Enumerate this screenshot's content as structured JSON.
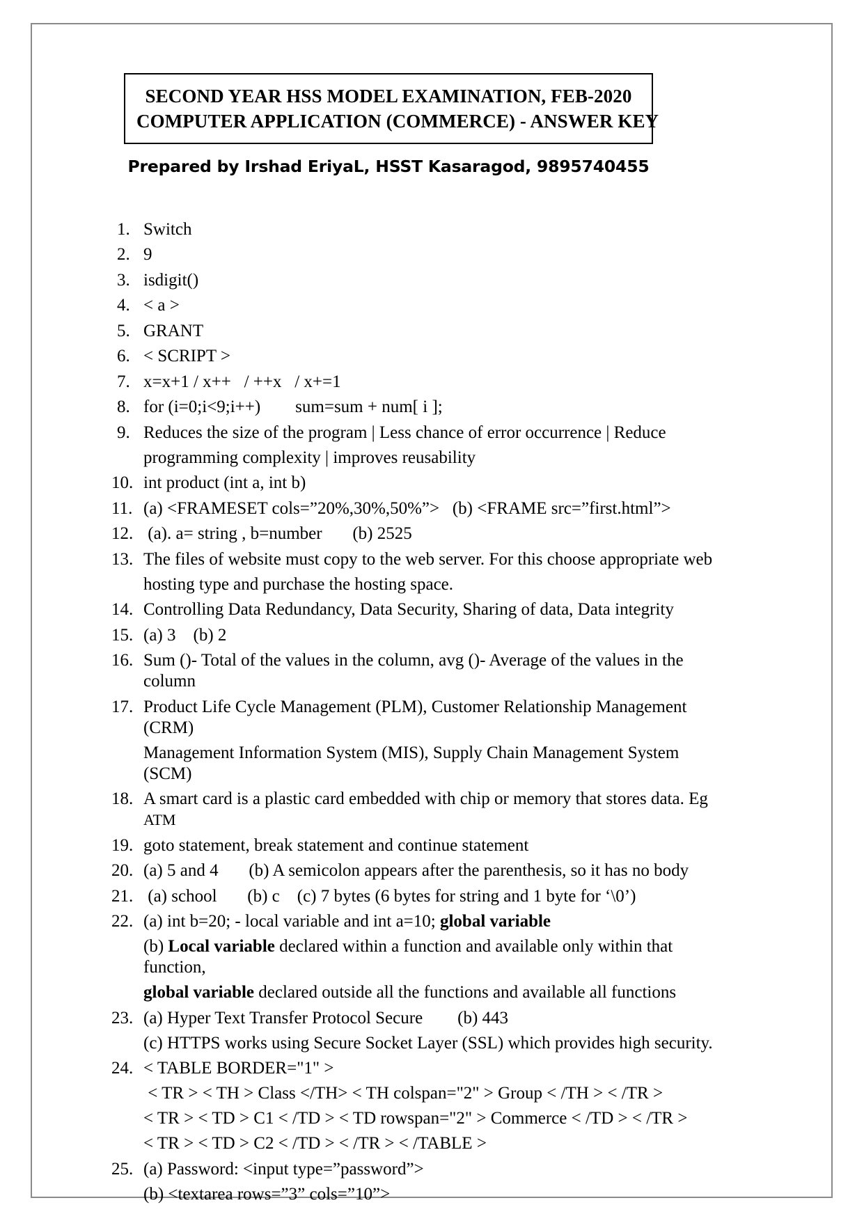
{
  "document": {
    "title_box": {
      "line1": "SECOND YEAR HSS MODEL EXAMINATION, FEB-2020",
      "line2": "COMPUTER APPLICATION (COMMERCE) - ANSWER KEY"
    },
    "subtitle": "Prepared by Irshad EriyaL, HSST Kasaragod, 9895740455",
    "answers": [
      {
        "num": "1.",
        "lines": [
          "Switch"
        ]
      },
      {
        "num": "2.",
        "lines": [
          "9"
        ]
      },
      {
        "num": "3.",
        "lines": [
          "isdigit()"
        ]
      },
      {
        "num": "4.",
        "lines": [
          "< a >"
        ]
      },
      {
        "num": "5.",
        "lines": [
          "GRANT"
        ]
      },
      {
        "num": "6.",
        "lines": [
          "< SCRIPT >"
        ]
      },
      {
        "num": "7.",
        "lines": [
          "x=x+1 / x++   / ++x   / x+=1"
        ]
      },
      {
        "num": "8.",
        "lines": [
          "for (i=0;i<9;i++)        sum=sum + num[ i ];"
        ]
      },
      {
        "num": "9.",
        "lines": [
          "Reduces the size of the program | Less chance of error occurrence | Reduce",
          "programming complexity | improves reusability"
        ]
      },
      {
        "num": "10.",
        "lines": [
          "int product (int a, int b)"
        ]
      },
      {
        "num": "11.",
        "lines": [
          "(a) <FRAMESET cols=”20%,30%,50%”>   (b) <FRAME src=”first.html”>"
        ]
      },
      {
        "num": "12.",
        "lines": [
          " (a). a= string , b=number       (b) 2525"
        ]
      },
      {
        "num": "13.",
        "lines": [
          "The files of website must copy to the web server. For this choose appropriate web",
          "hosting type and purchase the hosting space."
        ]
      },
      {
        "num": "14.",
        "lines": [
          "Controlling Data Redundancy, Data Security, Sharing of data, Data integrity"
        ]
      },
      {
        "num": "15.",
        "lines": [
          "(a) 3    (b) 2"
        ]
      },
      {
        "num": "16.",
        "lines": [
          "Sum ()- Total of the values in the column, avg ()- Average of the values in the column"
        ]
      },
      {
        "num": "17.",
        "lines": [
          "Product Life Cycle Management (PLM), Customer Relationship Management (CRM)",
          "Management Information System (MIS), Supply Chain Management System (SCM)"
        ]
      },
      {
        "num": "18.",
        "lines": [
          "A smart card is a plastic card embedded with chip or memory that stores data. Eg ATM"
        ]
      },
      {
        "num": "19.",
        "lines": [
          "goto statement, break statement and continue statement"
        ]
      },
      {
        "num": "20.",
        "lines": [
          "(a) 5 and 4       (b) A semicolon appears after the parenthesis, so it has no body"
        ]
      },
      {
        "num": "21.",
        "lines": [
          " (a) school       (b) c    (c) 7 bytes (6 bytes for string and 1 byte for ‘\\0’)"
        ]
      },
      {
        "num": "22.",
        "lines": [
          "(a) int b=20; - local variable and int a=10; global variable",
          "(b) Local variable declared within a function and available only within that function,",
          "global variable declared outside all the functions and available all functions"
        ],
        "bold_runs": [
          "Local variable",
          "global variable"
        ]
      },
      {
        "num": "23.",
        "lines": [
          "(a) Hyper Text Transfer Protocol Secure        (b) 443",
          "(c) HTTPS works using Secure Socket Layer (SSL) which provides high security."
        ]
      },
      {
        "num": "24.",
        "lines": [
          "< TABLE BORDER=\"1\" >",
          " < TR > < TH > Class </TH> < TH colspan=\"2\" > Group < /TH > < /TR >",
          "< TR > < TD > C1 < /TD > < TD rowspan=\"2\" > Commerce < /TD > < /TR >",
          "< TR > < TD > C2 < /TD > < /TR > < /TABLE >"
        ]
      },
      {
        "num": "25.",
        "lines": [
          "(a) Password: <input type=”password”>",
          "(b) <textarea rows=”3” cols=”10”>"
        ]
      }
    ]
  }
}
